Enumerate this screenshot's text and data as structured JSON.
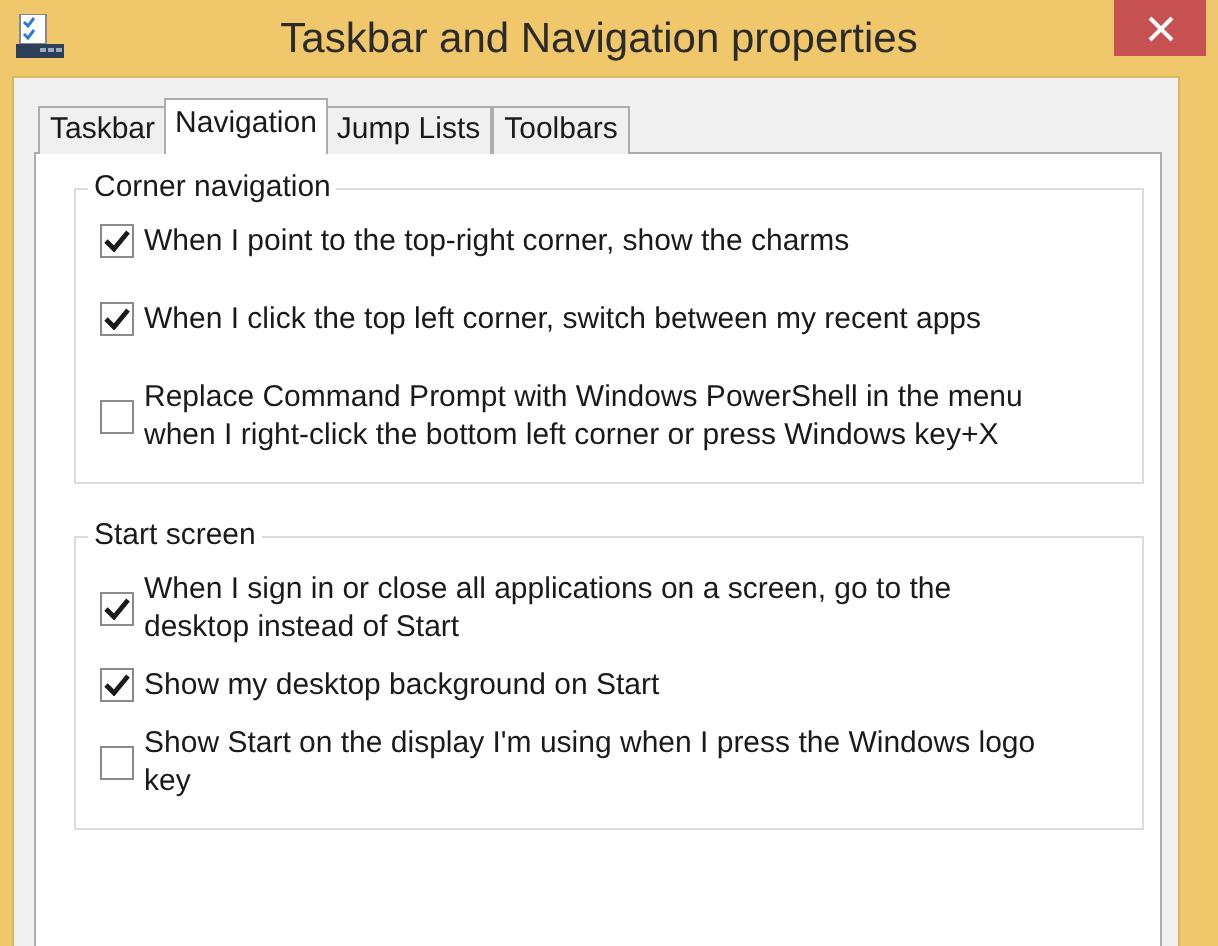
{
  "window": {
    "title": "Taskbar and Navigation properties"
  },
  "tabs": [
    {
      "label": "Taskbar",
      "selected": false
    },
    {
      "label": "Navigation",
      "selected": true
    },
    {
      "label": "Jump Lists",
      "selected": false
    },
    {
      "label": "Toolbars",
      "selected": false
    }
  ],
  "groups": [
    {
      "title": "Corner navigation",
      "options": [
        {
          "label": "When I point to the top-right corner, show the charms",
          "checked": true
        },
        {
          "label": "When I click the top left corner, switch between my recent apps",
          "checked": true
        },
        {
          "label": "Replace Command Prompt with Windows PowerShell in the menu when I right-click the bottom left corner or press Windows key+X",
          "checked": false
        }
      ]
    },
    {
      "title": "Start screen",
      "options": [
        {
          "label": "When I sign in or close all applications on a screen, go to the desktop instead of Start",
          "checked": true
        },
        {
          "label": "Show my desktop background on Start",
          "checked": true
        },
        {
          "label": "Show Start on the display I'm using when I press the Windows logo key",
          "checked": false
        }
      ]
    }
  ]
}
